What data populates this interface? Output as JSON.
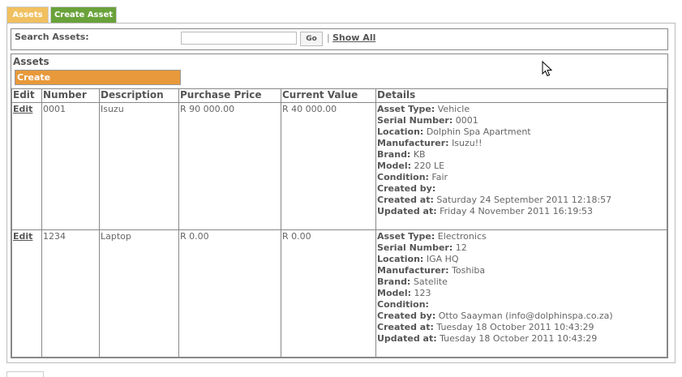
{
  "tabs": [
    {
      "label": "Assets",
      "active": true
    },
    {
      "label": "Create Asset",
      "active": false
    }
  ],
  "search": {
    "label": "Search Assets:",
    "value": "",
    "go_label": "Go",
    "separator": "|",
    "show_all_label": "Show All"
  },
  "assets": {
    "title": "Assets",
    "create_label": "Create",
    "columns": [
      "Edit",
      "Number",
      "Description",
      "Purchase Price",
      "Current Value",
      "Details"
    ],
    "rows": [
      {
        "edit": "Edit",
        "number": "0001",
        "description": "Isuzu",
        "purchase_price": "R 90 000.00",
        "current_value": "R 40 000.00",
        "details": [
          {
            "label": "Asset Type:",
            "value": "Vehicle"
          },
          {
            "label": "Serial Number:",
            "value": "0001"
          },
          {
            "label": "Location:",
            "value": "Dolphin Spa Apartment"
          },
          {
            "label": "Manufacturer:",
            "value": "Isuzu!!"
          },
          {
            "label": "Brand:",
            "value": "KB"
          },
          {
            "label": "Model:",
            "value": "220 LE"
          },
          {
            "label": "Condition:",
            "value": "Fair"
          },
          {
            "label": "Created by:",
            "value": ""
          },
          {
            "label": "Created at:",
            "value": "Saturday 24 September 2011 12:18:57"
          },
          {
            "label": "Updated at:",
            "value": "Friday 4 November 2011 16:19:53"
          }
        ]
      },
      {
        "edit": "Edit",
        "number": "1234",
        "description": "Laptop",
        "purchase_price": "R 0.00",
        "current_value": "R 0.00",
        "details": [
          {
            "label": "Asset Type:",
            "value": "Electronics"
          },
          {
            "label": "Serial Number:",
            "value": "12"
          },
          {
            "label": "Location:",
            "value": "IGA HQ"
          },
          {
            "label": "Manufacturer:",
            "value": "Toshiba"
          },
          {
            "label": "Brand:",
            "value": "Satelite"
          },
          {
            "label": "Model:",
            "value": "123"
          },
          {
            "label": "Condition:",
            "value": ""
          },
          {
            "label": "Created by:",
            "value": "Otto Saayman (info@dolphinspa.co.za)"
          },
          {
            "label": "Created at:",
            "value": "Tuesday 18 October 2011 10:43:29"
          },
          {
            "label": "Updated at:",
            "value": "Tuesday 18 October 2011 10:43:29"
          }
        ]
      }
    ]
  },
  "colors": {
    "tab_assets": "#f0c060",
    "tab_create": "#6aa23a",
    "create_button": "#e8993a"
  },
  "icons": {
    "cursor": "mouse-pointer-icon"
  }
}
